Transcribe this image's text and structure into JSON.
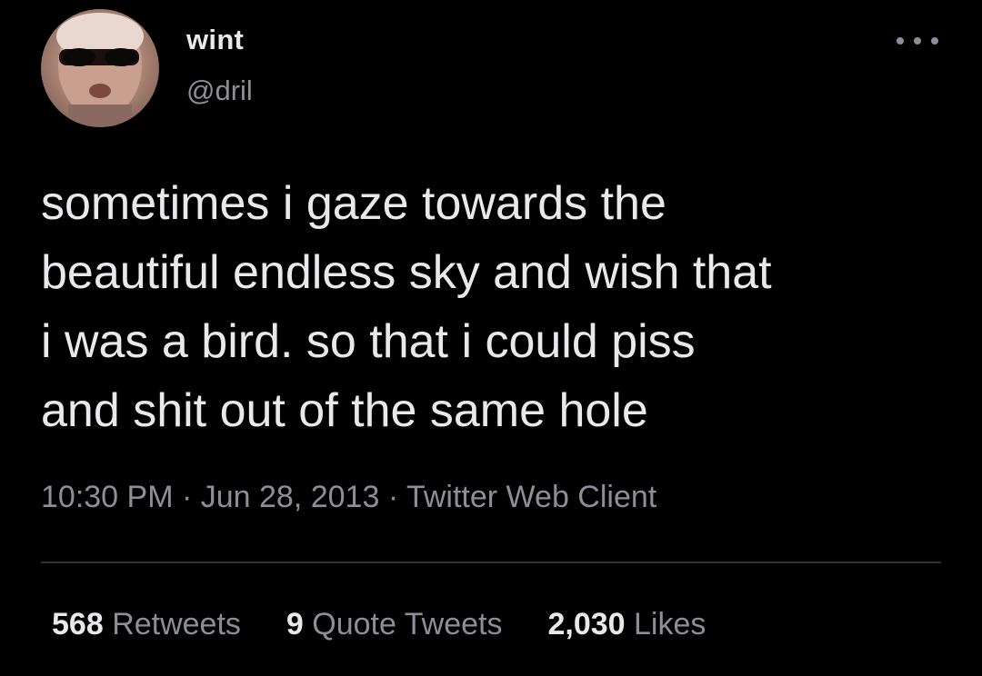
{
  "author": {
    "display_name": "wint",
    "handle": "@dril",
    "avatar_icon": "profile-photo"
  },
  "tweet": {
    "text": "sometimes i gaze towards the\nbeautiful endless sky and wish that\ni was a bird.  so that i could piss\nand shit out of the same hole"
  },
  "meta": {
    "time": "10:30 PM",
    "separator": " · ",
    "date": "Jun 28, 2013",
    "client": "Twitter Web Client"
  },
  "stats": {
    "retweets_count": "568",
    "retweets_label": "Retweets",
    "quotes_count": "9",
    "quotes_label": "Quote Tweets",
    "likes_count": "2,030",
    "likes_label": "Likes"
  },
  "colors": {
    "background": "#000000",
    "primary_text": "#e7e9ea",
    "secondary_text": "#8b9096",
    "divider": "#2f3336"
  },
  "icons": {
    "more": "more-horizontal-icon"
  }
}
